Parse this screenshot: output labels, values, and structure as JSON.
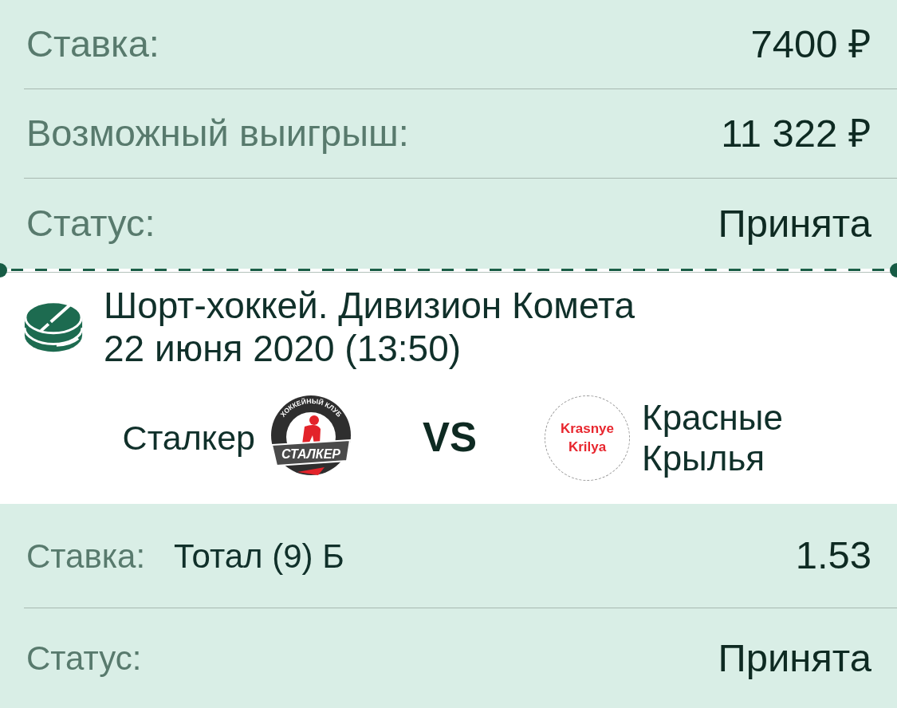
{
  "summary": [
    {
      "label": "Ставка:",
      "value": "7400 ₽"
    },
    {
      "label": "Возможный выигрыш:",
      "value": "11 322 ₽"
    },
    {
      "label": "Статус:",
      "value": "Принята"
    }
  ],
  "event": {
    "title": "Шорт-хоккей. Дивизион Комета",
    "date": "22 июня 2020 (13:50)",
    "home_team": {
      "name": "Сталкер",
      "logo_ring_text": "ХОККЕЙНЫЙ КЛУБ",
      "logo_banner_text": "СТАЛКЕР"
    },
    "versus": "VS",
    "away_team": {
      "name": "Красные Крылья",
      "logo_text": "Krasnye Krilya"
    }
  },
  "bet": {
    "label": "Ставка:",
    "selection": "Тотал (9) Б",
    "odds": "1.53"
  },
  "bet_status": {
    "label": "Статус:",
    "value": "Принята"
  }
}
